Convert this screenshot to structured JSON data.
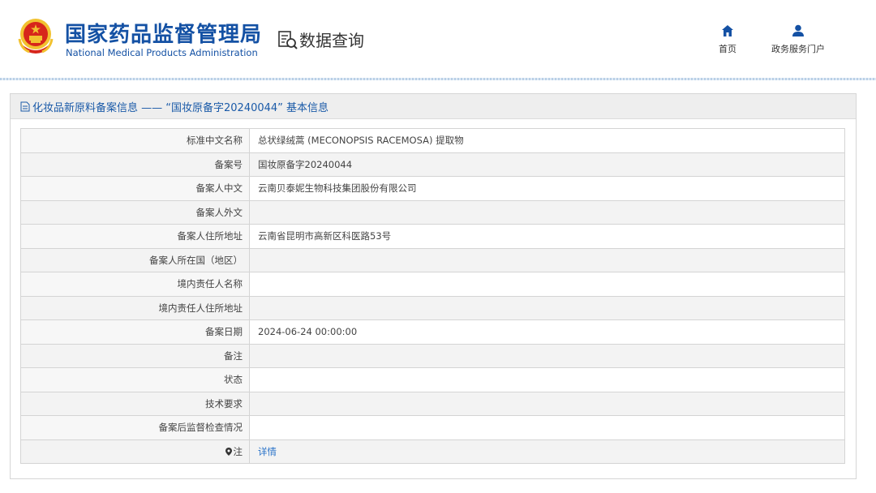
{
  "header": {
    "brand_cn": "国家药品监督管理局",
    "brand_en": "National Medical Products Administration",
    "query_label": "数据查询",
    "nav": [
      {
        "label": "首页",
        "icon": "home-icon"
      },
      {
        "label": "政务服务门户",
        "icon": "user-icon"
      }
    ]
  },
  "panel": {
    "title": "化妆品新原料备案信息 —— “国妆原备字20240044” 基本信息",
    "rows": [
      {
        "key": "标准中文名称",
        "value": "总状绿绒蒿 (MECONOPSIS RACEMOSA) 提取物"
      },
      {
        "key": "备案号",
        "value": "国妆原备字20240044"
      },
      {
        "key": "备案人中文",
        "value": "云南贝泰妮生物科技集团股份有限公司"
      },
      {
        "key": "备案人外文",
        "value": ""
      },
      {
        "key": "备案人住所地址",
        "value": "云南省昆明市高新区科医路53号"
      },
      {
        "key": "备案人所在国（地区）",
        "value": ""
      },
      {
        "key": "境内责任人名称",
        "value": ""
      },
      {
        "key": "境内责任人住所地址",
        "value": ""
      },
      {
        "key": "备案日期",
        "value": "2024-06-24 00:00:00"
      },
      {
        "key": "备注",
        "value": ""
      },
      {
        "key": "状态",
        "value": ""
      },
      {
        "key": "技术要求",
        "value": ""
      },
      {
        "key": "备案后监督检查情况",
        "value": ""
      }
    ],
    "note_key": "注",
    "note_link": "详情"
  },
  "colors": {
    "brand_blue": "#1451a4",
    "link_blue": "#2a73c9",
    "emblem_red": "#d7261b",
    "emblem_gold": "#f2c230"
  }
}
